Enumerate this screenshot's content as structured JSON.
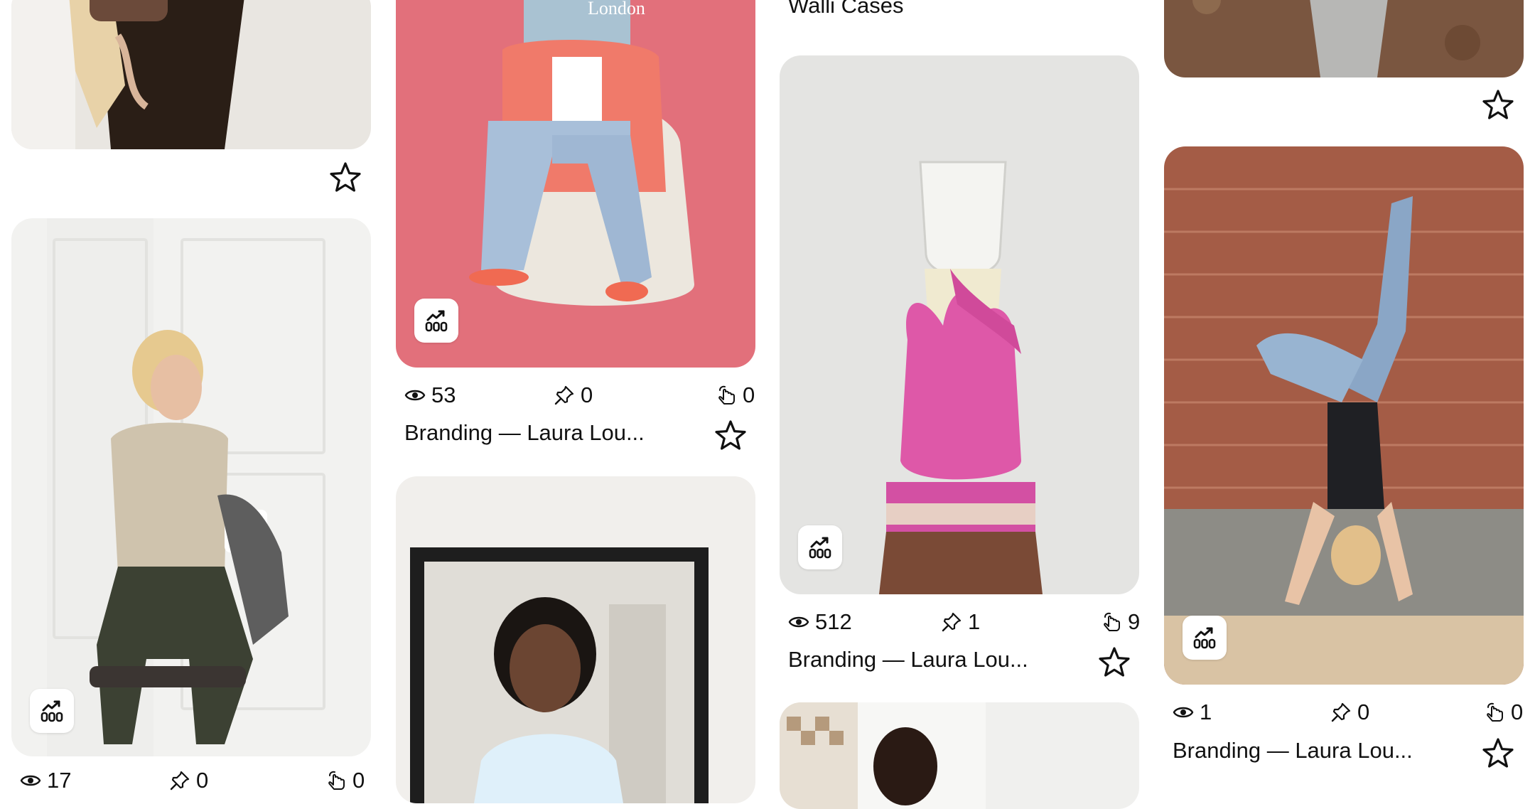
{
  "pins": [
    {
      "title": "Branding — Laura Lou...",
      "views": "53",
      "saves": "0",
      "clicks": "0"
    },
    {
      "title": "Branding — Laura Lou...",
      "views": "512",
      "saves": "1",
      "clicks": "9"
    },
    {
      "title": "Branding — Laura Lou...",
      "views": "1",
      "saves": "0",
      "clicks": "0"
    }
  ],
  "partial": {
    "col3_top_title": "Walli Cases",
    "col1_bottom_views": "17",
    "col1_bottom_saves": "0",
    "col1_bottom_clicks": "0"
  },
  "icons": {
    "analytics": "analytics-chart-icon",
    "views": "eye-icon",
    "saves": "pin-icon",
    "clicks": "tap-click-icon",
    "favorite": "star-outline-icon"
  },
  "colors": {
    "text": "#111111",
    "background": "#ffffff",
    "badge": "#ffffff"
  }
}
